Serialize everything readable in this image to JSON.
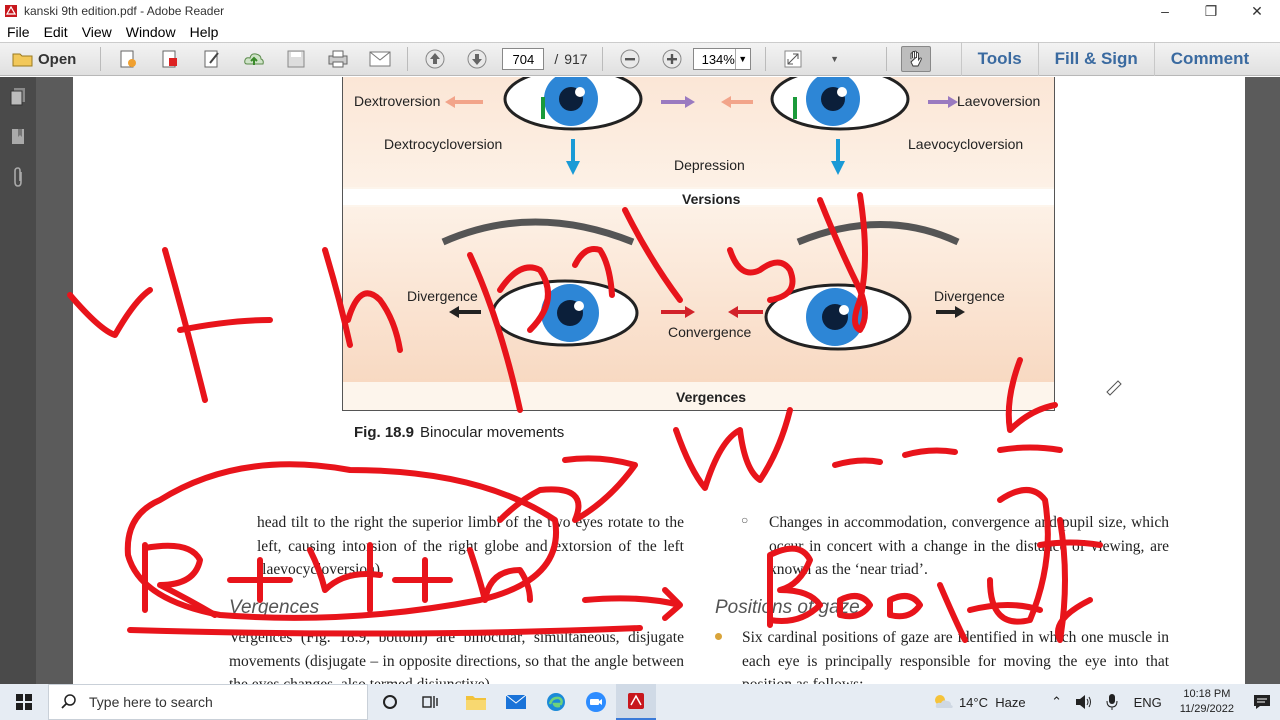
{
  "window": {
    "title": "kanski 9th edition.pdf - Adobe Reader"
  },
  "menu": [
    "File",
    "Edit",
    "View",
    "Window",
    "Help"
  ],
  "toolbar": {
    "open_label": "Open",
    "page_current": "704",
    "page_separator": "/",
    "page_total": "917",
    "zoom": "134%",
    "tools_label": "Tools",
    "fill_sign_label": "Fill & Sign",
    "comment_label": "Comment"
  },
  "figure": {
    "dextroversion": "Dextroversion",
    "laevoversion": "Laevoversion",
    "dextrocycloversion": "Dextrocycloversion",
    "laevocycloversion": "Laevocycloversion",
    "depression": "Depression",
    "versions": "Versions",
    "divergence_left": "Divergence",
    "divergence_right": "Divergence",
    "convergence": "Convergence",
    "vergences": "Vergences",
    "caption_num": "Fig. 18.9",
    "caption_text": "Binocular movements"
  },
  "body": {
    "left_para1": "head tilt to the right the superior limbi of the two eyes rotate to the left, causing intorsion of the right globe and extorsion of the left (laevocycloversion).",
    "left_heading": "Vergences",
    "left_para2": "Vergences (Fig. 18.9, bottom) are binocular, simultaneous, disjugate movements (disjugate – in opposite directions, so that the angle between the eyes changes, also termed disjunctive).",
    "right_bullet": "Changes in accommodation, convergence and pupil size, which occur in concert with a change in the distance of viewing, are known as the ‘near triad’.",
    "right_heading": "Positions of gaze",
    "right_para": "Six cardinal positions of gaze are identified in which one muscle in each eye is principally responsible for moving the eye into that position as follows:"
  },
  "taskbar": {
    "search_placeholder": "Type here to search",
    "weather": "14°C  Haze",
    "lang": "ENG",
    "time": "10:18 PM",
    "date": "11/29/2022"
  },
  "colors": {
    "ink": "#e8141b",
    "accent": "#3a6aa0"
  }
}
